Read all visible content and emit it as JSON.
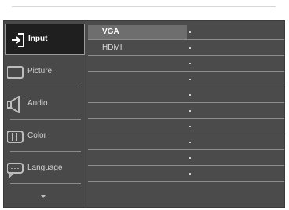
{
  "sidebar": {
    "items": [
      {
        "label": "Input",
        "icon": "input-icon",
        "selected": true
      },
      {
        "label": "Picture",
        "icon": "picture-icon",
        "selected": false
      },
      {
        "label": "Audio",
        "icon": "audio-icon",
        "selected": false
      },
      {
        "label": "Color",
        "icon": "color-icon",
        "selected": false
      },
      {
        "label": "Language",
        "icon": "language-icon",
        "selected": false
      }
    ],
    "more_icon": "chevron-down-icon"
  },
  "submenu": {
    "items": [
      {
        "label": "VGA",
        "selected": true
      },
      {
        "label": "HDMI",
        "selected": false
      },
      {
        "label": "",
        "selected": false
      },
      {
        "label": "",
        "selected": false
      },
      {
        "label": "",
        "selected": false
      },
      {
        "label": "",
        "selected": false
      },
      {
        "label": "",
        "selected": false
      },
      {
        "label": "",
        "selected": false
      },
      {
        "label": "",
        "selected": false
      },
      {
        "label": "",
        "selected": false
      }
    ]
  },
  "colors": {
    "osd_background": "#4b4b4b",
    "selected_menu": "#1f1f1f",
    "selected_row": "#6e6e6e"
  }
}
